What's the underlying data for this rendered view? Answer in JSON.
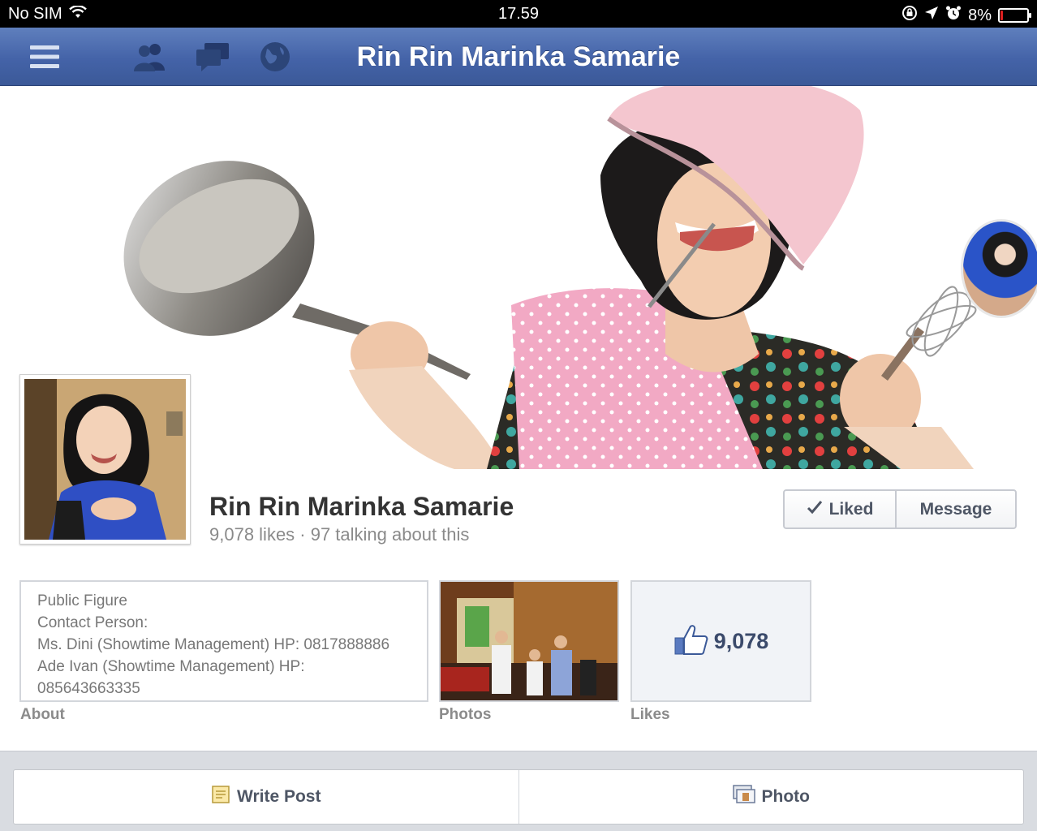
{
  "status_bar": {
    "carrier": "No SIM",
    "time": "17.59",
    "battery_percent": "8%",
    "battery_level": 0.08
  },
  "nav": {
    "title": "Rin Rin Marinka Samarie",
    "icons": [
      "menu-icon",
      "friends-icon",
      "messages-icon",
      "notifications-globe-icon"
    ]
  },
  "profile": {
    "name": "Rin Rin Marinka Samarie",
    "stats": "9,078 likes · 97 talking about this",
    "liked_label": "Liked",
    "message_label": "Message"
  },
  "about": {
    "lines": [
      "Public Figure",
      "Contact Person:",
      "Ms. Dini (Showtime Management) HP: 0817888886",
      "Ade Ivan (Showtime Management) HP:",
      "085643663335"
    ],
    "label": "About"
  },
  "photos": {
    "label": "Photos"
  },
  "likes": {
    "count": "9,078",
    "label": "Likes"
  },
  "actions": {
    "write_post": "Write Post",
    "photo": "Photo"
  },
  "colors": {
    "brand_blue": "#3b5998",
    "battery_low": "#e02020"
  }
}
